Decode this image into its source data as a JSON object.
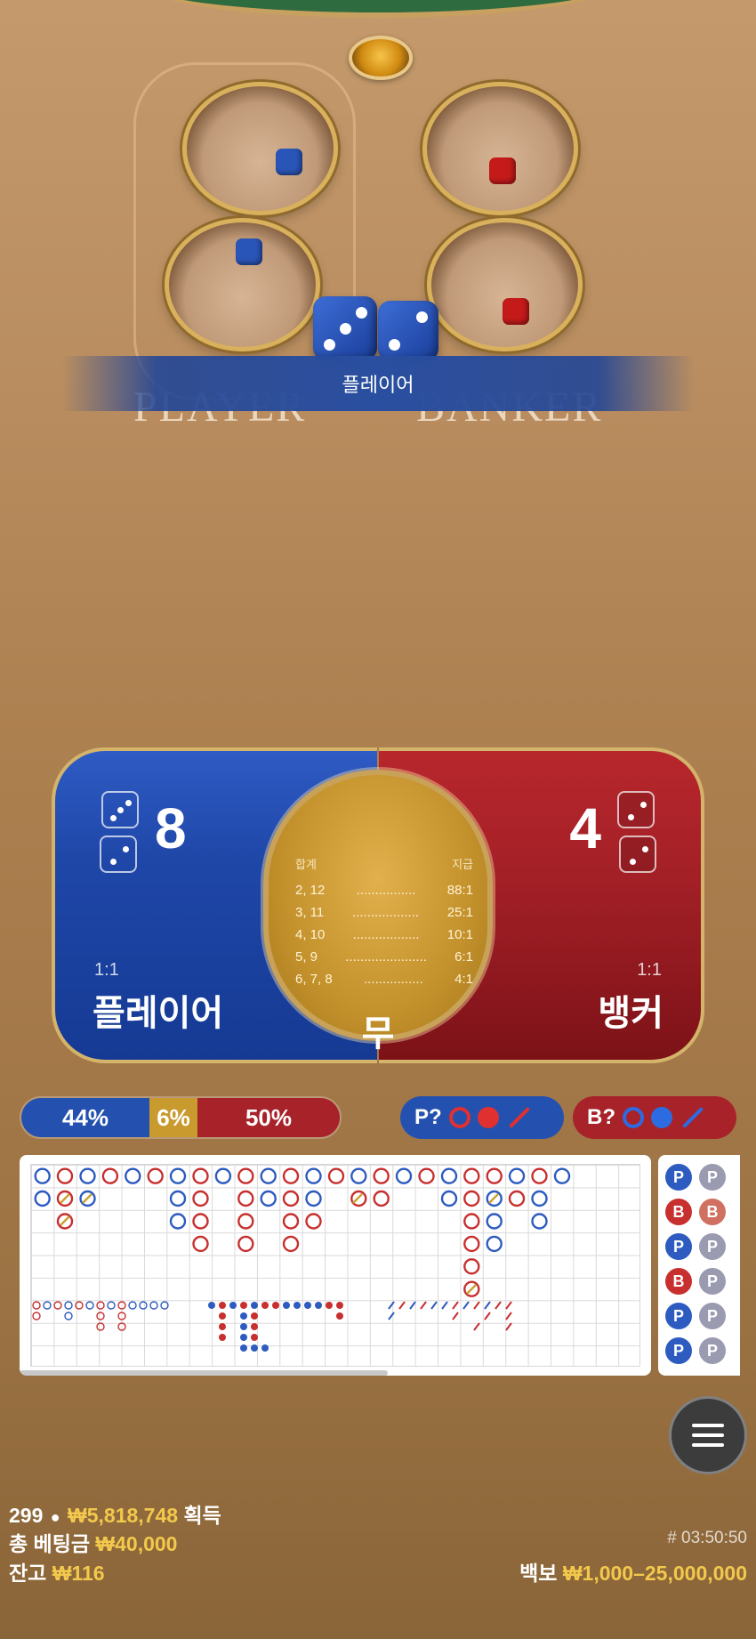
{
  "scene": {
    "banner_label": "플레이어",
    "table_player_text": "PLAYER",
    "table_banker_text": "BANKER"
  },
  "player": {
    "score": "8",
    "odds": "1:1",
    "name": "플레이어",
    "dice": [
      3,
      2
    ],
    "color": "#1f47a8"
  },
  "banker": {
    "score": "4",
    "odds": "1:1",
    "name": "뱅커",
    "dice": [
      2,
      2
    ],
    "color": "#a11f26"
  },
  "tie": {
    "name": "무",
    "header_sum": "합계",
    "header_pay": "지급",
    "rows": [
      {
        "sum": "2, 12",
        "dots": "................",
        "pay": "88:1"
      },
      {
        "sum": "3, 11",
        "dots": "..................",
        "pay": "25:1"
      },
      {
        "sum": "4, 10",
        "dots": "..................",
        "pay": "10:1"
      },
      {
        "sum": "5, 9",
        "dots": "......................",
        "pay": "6:1"
      },
      {
        "sum": "6, 7, 8",
        "dots": "................",
        "pay": "4:1"
      }
    ]
  },
  "stats": {
    "player_pct": "44%",
    "tie_pct": "6%",
    "banker_pct": "50%"
  },
  "ask": {
    "player_label": "P?",
    "banker_label": "B?"
  },
  "roadmap_side": [
    [
      "P",
      "P"
    ],
    [
      "B",
      "B"
    ],
    [
      "P",
      "P"
    ],
    [
      "B",
      "P"
    ],
    [
      "P",
      "P"
    ],
    [
      "P",
      "P"
    ]
  ],
  "footer": {
    "players": "299",
    "winnings": "₩5,818,748",
    "winnings_label": "획득",
    "total_bet_label": "총 베팅금",
    "total_bet": "₩40,000",
    "balance_label": "잔고",
    "balance": "₩116",
    "game_id": "# 03:50:50",
    "limits_label": "백보",
    "limits": "₩1,000–25,000,000"
  }
}
